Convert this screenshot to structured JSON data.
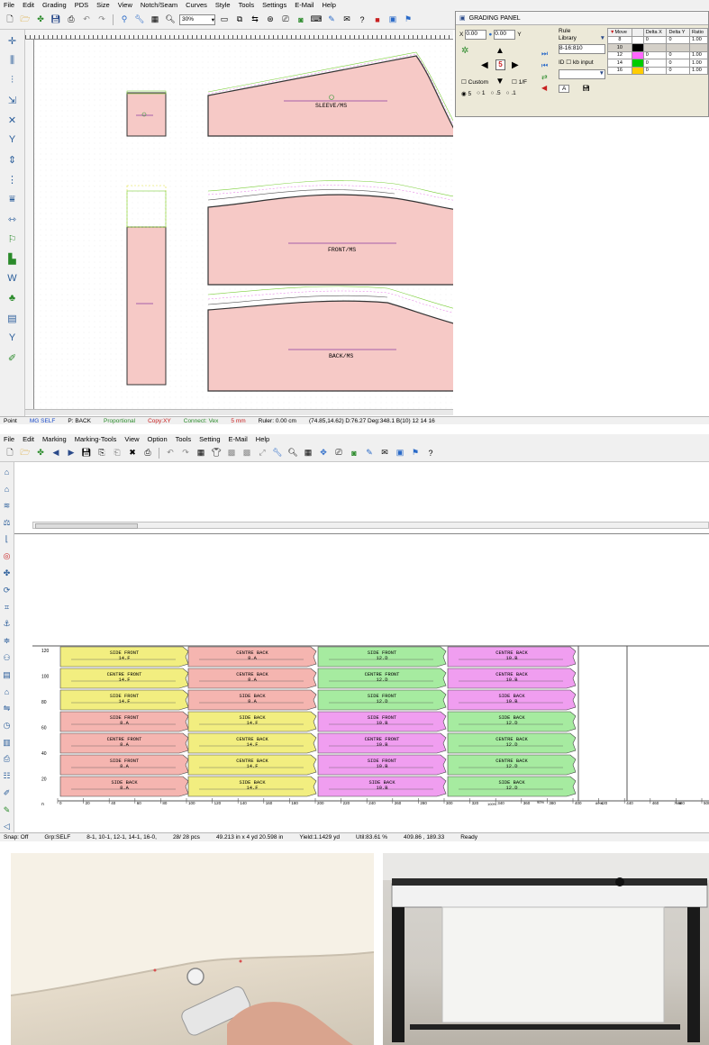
{
  "grading_app": {
    "menu": [
      "File",
      "Edit",
      "Grading",
      "PDS",
      "Size",
      "View",
      "Notch/Seam",
      "Curves",
      "Style",
      "Tools",
      "Settings",
      "E-Mail",
      "Help"
    ],
    "zoom": "30%",
    "piece_labels": [
      "SLEEVE/MS",
      "FRONT/MS",
      "BACK/MS"
    ],
    "status": {
      "mode": "Point",
      "group": "MG SELF",
      "piece": "P: BACK",
      "proportional": "Proportional",
      "copy": "Copy:XY",
      "connect": "Connect: Vex",
      "step": "5 mm",
      "ruler": "Ruler: 0.00 cm",
      "coords": "(74.85,14.62) D:76.27 Deg:348.1 B(10) 12 14 16"
    },
    "grading_panel": {
      "title": "GRADING PANEL",
      "x_value": "0.00",
      "y_value": "0.00",
      "x_label": "X",
      "y_label": "Y",
      "rule_label": "Rule",
      "library": "Library",
      "rule_value": "8-16:810",
      "id_label": "ID",
      "kb_input": "kb input",
      "custom": "Custom",
      "step_center": "5",
      "quarter": "1/F",
      "radios": [
        "5",
        "1",
        ".5",
        ".1"
      ],
      "a_button": "A",
      "headers": [
        "Move",
        "Delta X",
        "Delta Y",
        "Ratio"
      ],
      "rows": [
        {
          "size": "8",
          "color": "#ffffff",
          "dx": "0",
          "dy": "0",
          "ratio": "1.00"
        },
        {
          "size": "10",
          "color": "#000000",
          "dx": "",
          "dy": "",
          "ratio": ""
        },
        {
          "size": "12",
          "color": "#ff66ff",
          "dx": "0",
          "dy": "0",
          "ratio": "1.00"
        },
        {
          "size": "14",
          "color": "#00cc00",
          "dx": "0",
          "dy": "0",
          "ratio": "1.00"
        },
        {
          "size": "16",
          "color": "#ffcc00",
          "dx": "0",
          "dy": "0",
          "ratio": "1.00"
        }
      ]
    }
  },
  "marker_app": {
    "menu": [
      "File",
      "Edit",
      "Marking",
      "Marking-Tools",
      "View",
      "Option",
      "Tools",
      "Setting",
      "E-Mail",
      "Help"
    ],
    "y_ticks": [
      "120",
      "100",
      "80",
      "60",
      "40",
      "20",
      "0"
    ],
    "x_ticks": [
      "0",
      "20",
      "40",
      "60",
      "80",
      "100",
      "120",
      "140",
      "160",
      "180",
      "200",
      "220",
      "240",
      "260",
      "280",
      "300",
      "320",
      "340",
      "360",
      "380",
      "400",
      "420",
      "440",
      "460",
      "480",
      "500"
    ],
    "percent_labels": [
      "100%",
      "90%",
      "80%",
      "75%"
    ],
    "pieces": [
      {
        "label": "SIDE FRONT\n14.F",
        "color": "#f2ee80"
      },
      {
        "label": "CENTRE FRONT\n14.F",
        "color": "#f2ee80"
      },
      {
        "label": "SIDE FRONT\n14.F",
        "color": "#f2ee80"
      },
      {
        "label": "SIDE FRONT\n8.A",
        "color": "#f5b5b0"
      },
      {
        "label": "CENTRE FRONT\n8.A",
        "color": "#f5b5b0"
      },
      {
        "label": "SIDE FRONT\n8.A",
        "color": "#f5b5b0"
      },
      {
        "label": "SIDE BACK\n8.A",
        "color": "#f5b5b0"
      },
      {
        "label": "CENTRE BACK\n8.A",
        "color": "#f5b5b0"
      },
      {
        "label": "CENTRE BACK\n8.A",
        "color": "#f5b5b0"
      },
      {
        "label": "SIDE BACK\n8.A",
        "color": "#f5b5b0"
      },
      {
        "label": "SIDE BACK\n14.F",
        "color": "#f2ee80"
      },
      {
        "label": "CENTRE BACK\n14.F",
        "color": "#f2ee80"
      },
      {
        "label": "CENTRE BACK\n14.F",
        "color": "#f2ee80"
      },
      {
        "label": "SIDE BACK\n14.F",
        "color": "#f2ee80"
      },
      {
        "label": "SIDE FRONT\n12.D",
        "color": "#a6eba0"
      },
      {
        "label": "CENTRE FRONT\n12.D",
        "color": "#a6eba0"
      },
      {
        "label": "SIDE FRONT\n12.D",
        "color": "#a6eba0"
      },
      {
        "label": "SIDE FRONT\n10.B",
        "color": "#f09ef0"
      },
      {
        "label": "CENTRE FRONT\n10.B",
        "color": "#f09ef0"
      },
      {
        "label": "SIDE FRONT\n10.B",
        "color": "#f09ef0"
      },
      {
        "label": "SIDE BACK\n10.B",
        "color": "#f09ef0"
      },
      {
        "label": "CENTRE BACK\n10.B",
        "color": "#f09ef0"
      },
      {
        "label": "CENTRE BACK\n10.B",
        "color": "#f09ef0"
      },
      {
        "label": "SIDE BACK\n10.B",
        "color": "#f09ef0"
      },
      {
        "label": "SIDE BACK\n12.D",
        "color": "#a6eba0"
      },
      {
        "label": "CENTRE BACK\n12.D",
        "color": "#a6eba0"
      },
      {
        "label": "CENTRE BACK\n12.D",
        "color": "#a6eba0"
      },
      {
        "label": "SIDE BACK\n12.D",
        "color": "#a6eba0"
      }
    ],
    "status": {
      "snap": "Snap: Off",
      "group": "Grp:SELF",
      "sizes": "8-1, 10-1, 12-1, 14-1, 16-0,",
      "pieces": "28/ 28 pcs",
      "length": "49.213 in x 4 yd 20.598 in",
      "yield": "Yield:1.1429 yd",
      "util": "Util:83.61 %",
      "dims": "409.86 , 189.33",
      "ready": "Ready"
    }
  },
  "colors": {
    "piece_fill": "#f6c9c6",
    "grade_green": "#7ccf3a",
    "grade_yellow": "#e2e23a",
    "grade_pink": "#e673e6",
    "marker_pink": "#f5b5b0",
    "marker_yellow": "#f2ee80",
    "marker_green": "#a6eba0",
    "marker_violet": "#f09ef0"
  }
}
